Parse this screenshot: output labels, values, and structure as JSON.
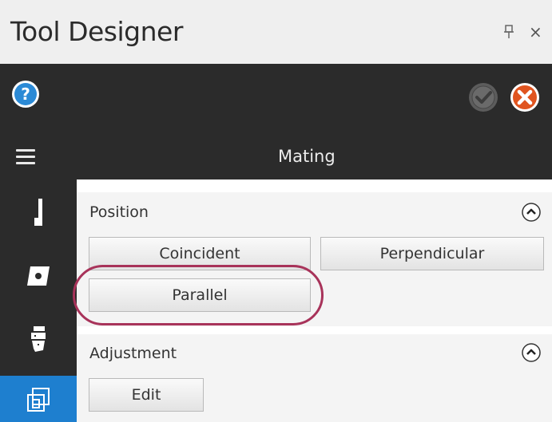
{
  "window": {
    "title": "Tool Designer",
    "pin_glyph": "⍐",
    "close_glyph": "×"
  },
  "toolbar": {
    "help_glyph": "?"
  },
  "header": {
    "title": "Mating"
  },
  "sections": {
    "position": {
      "label": "Position",
      "buttons": {
        "coincident": "Coincident",
        "perpendicular": "Perpendicular",
        "parallel": "Parallel"
      }
    },
    "adjustment": {
      "label": "Adjustment",
      "buttons": {
        "edit": "Edit"
      }
    }
  },
  "colors": {
    "dark_bg": "#2b2b2b",
    "active_blue": "#1e7fcf",
    "help_blue": "#2b8ad6",
    "cancel_orange": "#e0541f",
    "highlight_ring": "#a8335a"
  },
  "icons": {
    "help": "help-icon",
    "ok": "check-icon",
    "cancel": "cancel-icon",
    "menu": "hamburger-icon",
    "sidebar": [
      "tool-holder-icon",
      "insert-icon",
      "drill-tool-icon",
      "assembly-icon"
    ]
  }
}
